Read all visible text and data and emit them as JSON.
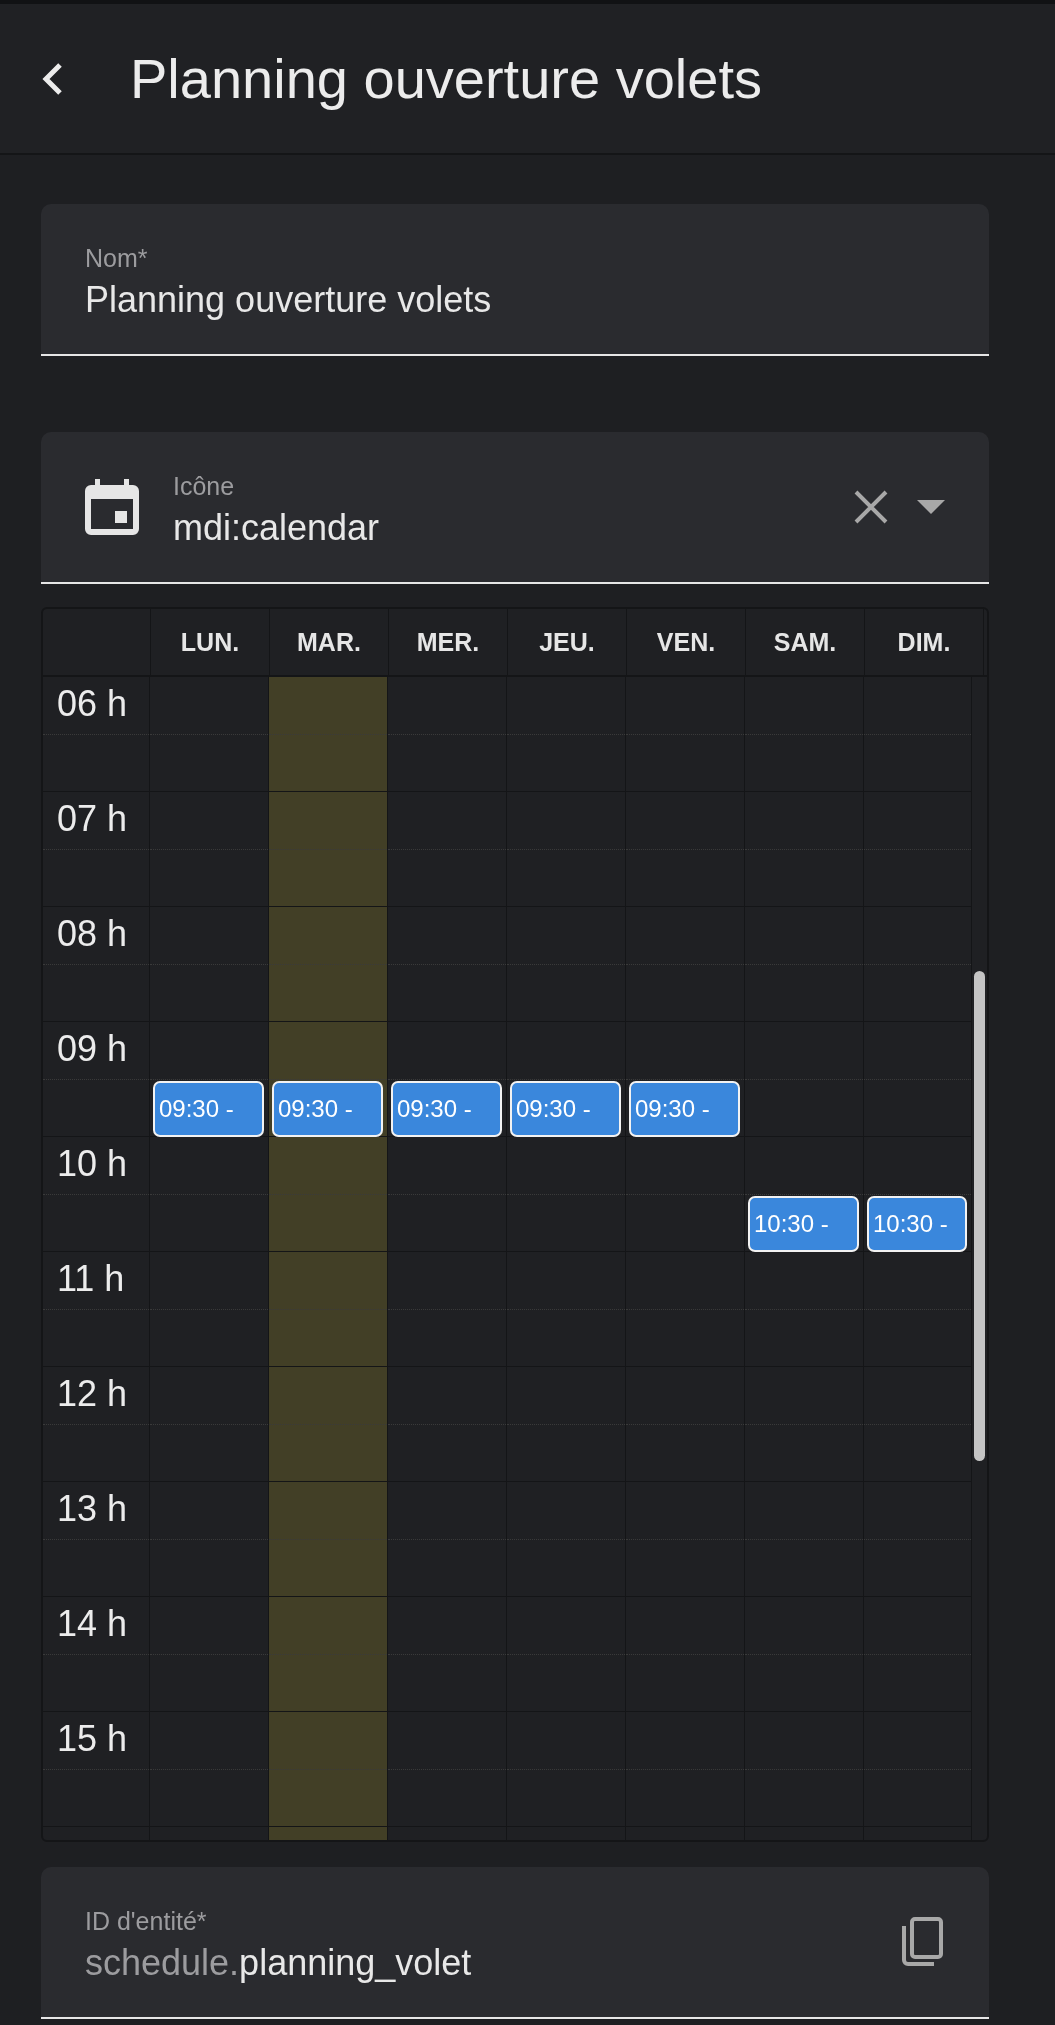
{
  "header": {
    "title": "Planning ouverture volets"
  },
  "name_field": {
    "label": "Nom*",
    "value": "Planning ouverture volets"
  },
  "icon_field": {
    "label": "Icône",
    "value": "mdi:calendar"
  },
  "calendar": {
    "days": [
      {
        "label": "LUN.",
        "today": false,
        "events": [
          {
            "label": "09:30 -"
          }
        ]
      },
      {
        "label": "MAR.",
        "today": true,
        "events": [
          {
            "label": "09:30 -"
          }
        ]
      },
      {
        "label": "MER.",
        "today": false,
        "events": [
          {
            "label": "09:30 -"
          }
        ]
      },
      {
        "label": "JEU.",
        "today": false,
        "events": [
          {
            "label": "09:30 -"
          }
        ]
      },
      {
        "label": "VEN.",
        "today": false,
        "events": [
          {
            "label": "09:30 -"
          }
        ]
      },
      {
        "label": "SAM.",
        "today": false,
        "events": [
          {
            "label": "10:30 -"
          }
        ]
      },
      {
        "label": "DIM.",
        "today": false,
        "events": [
          {
            "label": "10:30 -"
          }
        ]
      }
    ],
    "hours": [
      "06 h",
      "07 h",
      "08 h",
      "09 h",
      "10 h",
      "11 h",
      "12 h",
      "13 h",
      "14 h",
      "15 h"
    ]
  },
  "entity_id_field": {
    "label": "ID d'entité*",
    "prefix": "schedule.",
    "value": "planning_volet"
  }
}
